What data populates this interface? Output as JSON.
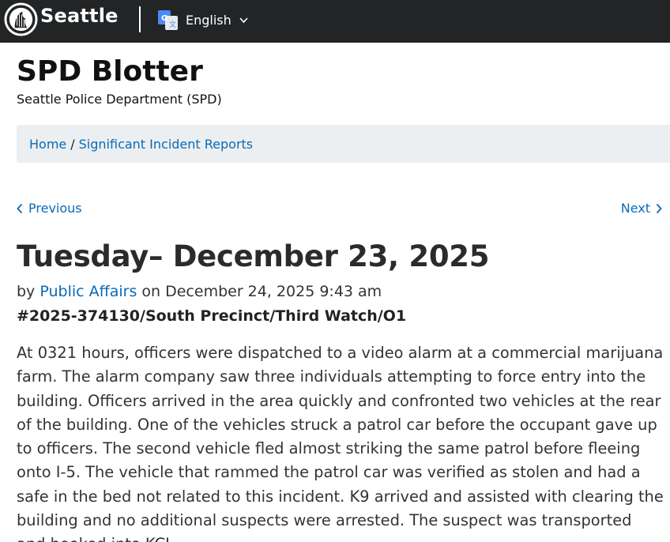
{
  "header": {
    "brand": "Seattle",
    "language": "English"
  },
  "site": {
    "title": "SPD Blotter",
    "subtitle": "Seattle Police Department (SPD)"
  },
  "breadcrumb": {
    "home": "Home",
    "separator": "/",
    "section": "Significant Incident Reports"
  },
  "pager": {
    "previous": "Previous",
    "next": "Next"
  },
  "post": {
    "title": "Tuesday– December 23, 2025",
    "by_prefix": "by",
    "author": "Public Affairs",
    "on_text": "on December 24, 2025 9:43 am",
    "case": "#2025-374130/South Precinct/Third Watch/O1",
    "body": "At 0321 hours, officers were dispatched to a video alarm at a commercial marijuana farm. The alarm company saw three individuals attempting to force entry into the building. Officers arrived in the area quickly and confronted two vehicles at the rear of the building. One of the vehicles struck a patrol car before the occupant gave up to officers. The second vehicle fled almost striking the same patrol before fleeing onto I-5. The vehicle that rammed the patrol car was verified as stolen and had a safe in the bed not related to this incident. K9 arrived and assisted with clearing the building and no additional suspects were arrested. The suspect was transported and booked into KCJ."
  },
  "colors": {
    "topbar": "#222426",
    "link": "#0a6ab6",
    "breadcrumb_bg": "#eceff1"
  },
  "icons": {
    "logo": "seattle-seal-icon",
    "translate": "google-translate-icon",
    "caret": "chevron-down-icon",
    "prev": "chevron-left-icon",
    "next": "chevron-right-icon"
  }
}
